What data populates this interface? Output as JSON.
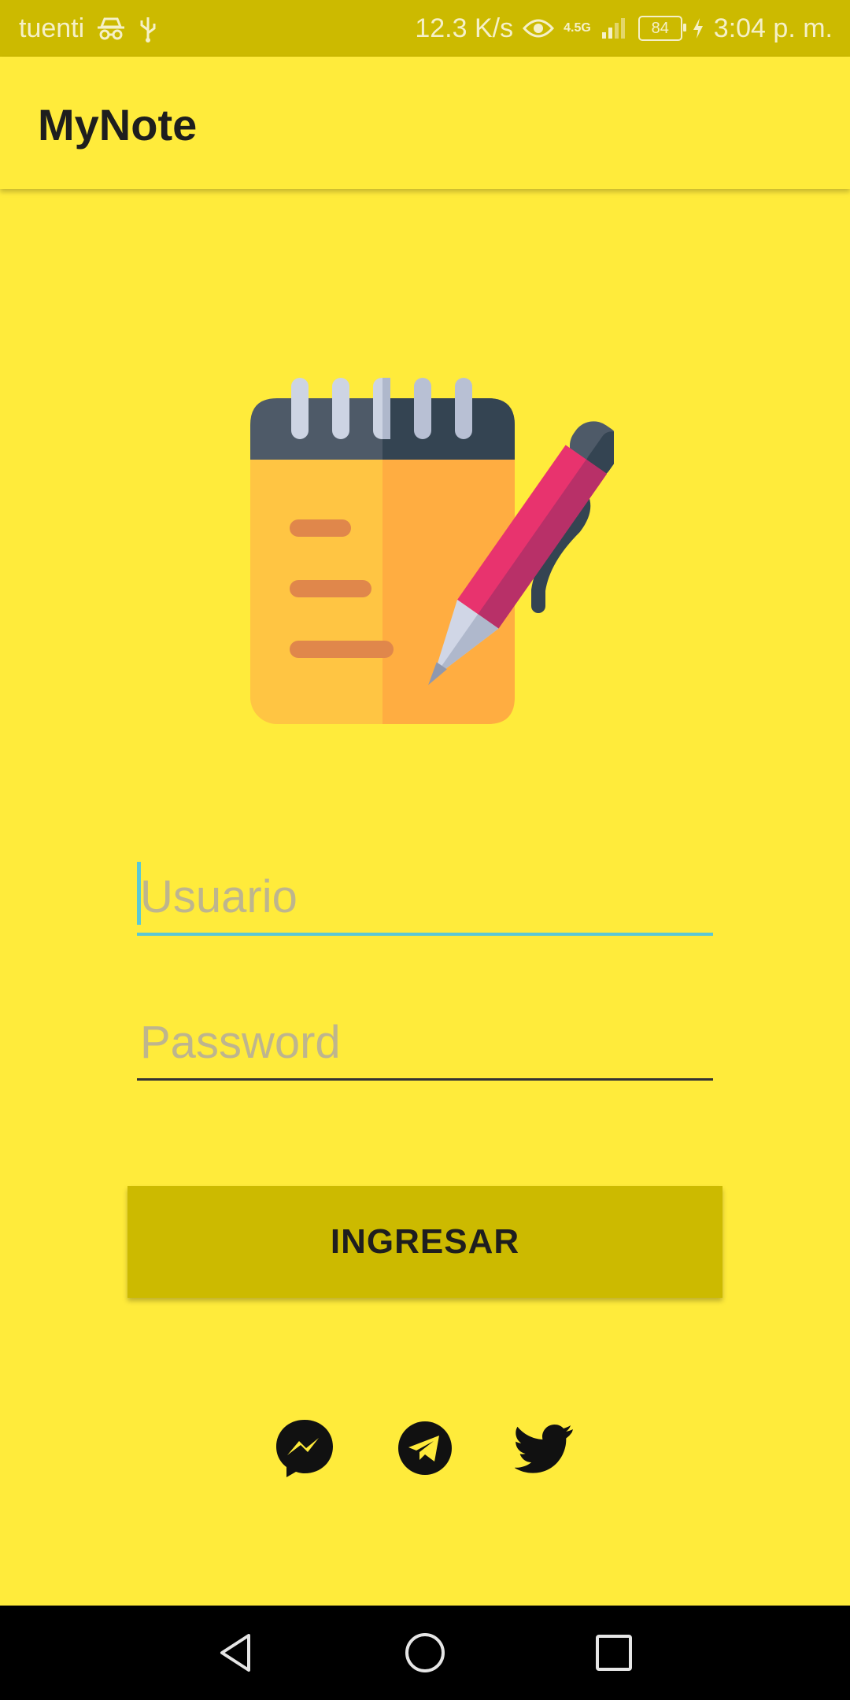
{
  "status_bar": {
    "carrier": "tuenti",
    "speed": "12.3 K/s",
    "network_type": "4.5G",
    "battery": "84",
    "time": "3:04 p. m.",
    "icons": [
      "incognito-icon",
      "usb-icon",
      "eye-icon",
      "signal-icon",
      "charging-icon"
    ]
  },
  "app_bar": {
    "title": "MyNote"
  },
  "illustration": {
    "icon": "notepad-pen-icon"
  },
  "login_form": {
    "username_placeholder": "Usuario",
    "username_value": "",
    "password_placeholder": "Password",
    "password_value": "",
    "submit_label": "INGRESAR"
  },
  "social": [
    {
      "name": "messenger-icon"
    },
    {
      "name": "telegram-icon"
    },
    {
      "name": "twitter-icon"
    }
  ],
  "nav_bar": {
    "buttons": [
      "back-icon",
      "home-icon",
      "recents-icon"
    ]
  },
  "colors": {
    "background": "#FFEB3B",
    "status_bar": "#CCBA00",
    "button": "#CCBA00",
    "focus_accent": "#5BC8D4",
    "nav_bar": "#000000"
  }
}
